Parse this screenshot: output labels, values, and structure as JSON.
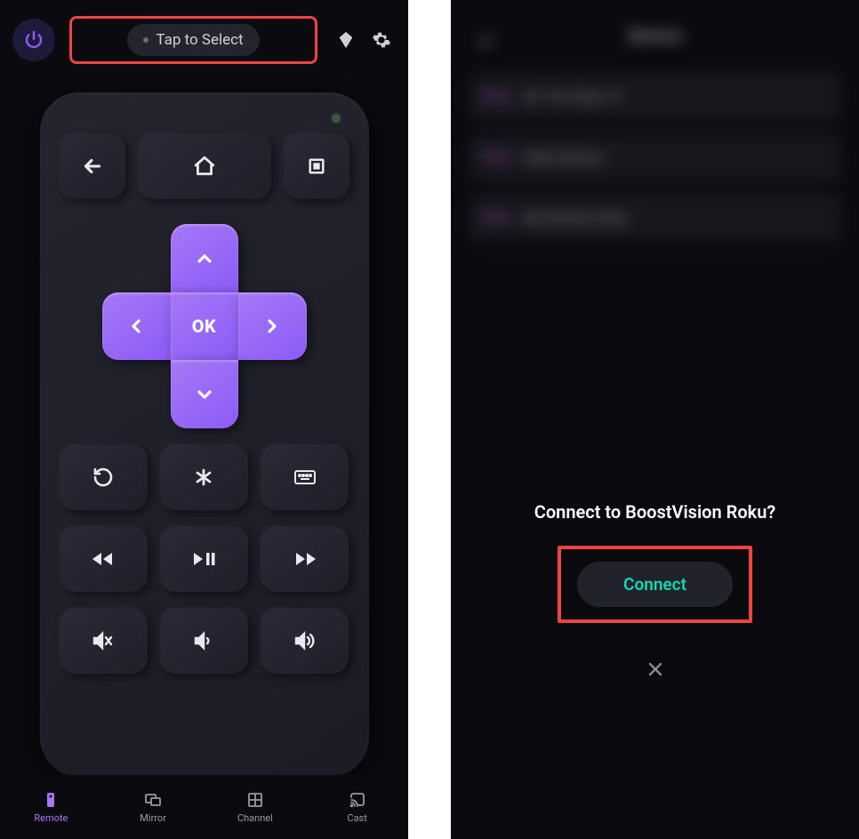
{
  "left": {
    "header": {
      "tap_select": "Tap to Select"
    },
    "dpad": {
      "ok": "OK"
    },
    "nav": {
      "remote": "Remote",
      "mirror": "Mirror",
      "channel": "Channel",
      "cast": "Cast"
    }
  },
  "right": {
    "blur": {
      "title": "Device",
      "rows": [
        {
          "tag": "Roku",
          "name": "65\" TCL Roku TV"
        },
        {
          "tag": "Roku",
          "name": "Roku Express"
        },
        {
          "tag": "Roku",
          "name": "BoostVision Roku"
        }
      ]
    },
    "sheet": {
      "title": "Connect to BoostVision Roku?",
      "connect": "Connect"
    }
  }
}
